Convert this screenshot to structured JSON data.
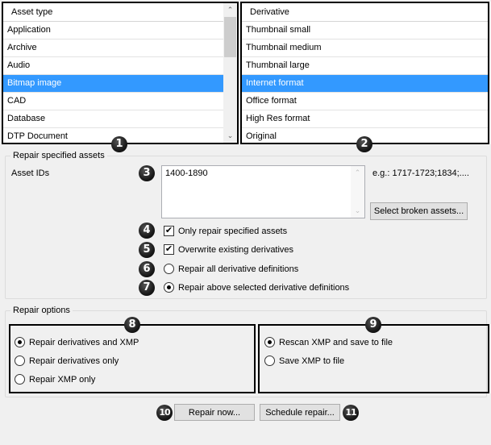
{
  "asset_type_list": {
    "header": "Asset type",
    "items": [
      {
        "label": "Application",
        "selected": false
      },
      {
        "label": "Archive",
        "selected": false
      },
      {
        "label": "Audio",
        "selected": false
      },
      {
        "label": "Bitmap image",
        "selected": true
      },
      {
        "label": "CAD",
        "selected": false
      },
      {
        "label": "Database",
        "selected": false
      },
      {
        "label": "DTP Document",
        "selected": false
      }
    ],
    "scroll_up": "⌃",
    "scroll_down": "⌄"
  },
  "derivative_list": {
    "header": "Derivative",
    "items": [
      {
        "label": "Thumbnail small",
        "selected": false
      },
      {
        "label": "Thumbnail medium",
        "selected": false
      },
      {
        "label": "Thumbnail large",
        "selected": false
      },
      {
        "label": "Internet format",
        "selected": true
      },
      {
        "label": "Office format",
        "selected": false
      },
      {
        "label": "High Res format",
        "selected": false
      },
      {
        "label": "Original",
        "selected": false
      }
    ]
  },
  "repair_specified": {
    "title": "Repair specified assets",
    "asset_ids_label": "Asset IDs",
    "asset_ids_value": "1400-1890",
    "example_hint": "e.g.: 1717-1723;1834;....",
    "select_broken_button": "Select broken assets...",
    "only_repair_specified": {
      "label": "Only repair specified assets",
      "checked": true
    },
    "overwrite_existing": {
      "label": "Overwrite existing derivatives",
      "checked": true
    },
    "repair_all_defs": {
      "label": "Repair all derivative definitions",
      "selected": false
    },
    "repair_selected_defs": {
      "label": "Repair above selected derivative definitions",
      "selected": true
    }
  },
  "repair_options": {
    "title": "Repair options",
    "left_group": [
      {
        "label": "Repair derivatives and XMP",
        "selected": true
      },
      {
        "label": "Repair derivatives only",
        "selected": false
      },
      {
        "label": "Repair XMP only",
        "selected": false
      }
    ],
    "right_group": [
      {
        "label": "Rescan XMP and save to file",
        "selected": true
      },
      {
        "label": "Save XMP to file",
        "selected": false
      }
    ]
  },
  "buttons": {
    "repair_now": "Repair now...",
    "schedule_repair": "Schedule repair..."
  },
  "badges": [
    "1",
    "2",
    "3",
    "4",
    "5",
    "6",
    "7",
    "8",
    "9",
    "10",
    "11"
  ],
  "colors": {
    "selection": "#3399ff",
    "annotation": "#000000"
  }
}
